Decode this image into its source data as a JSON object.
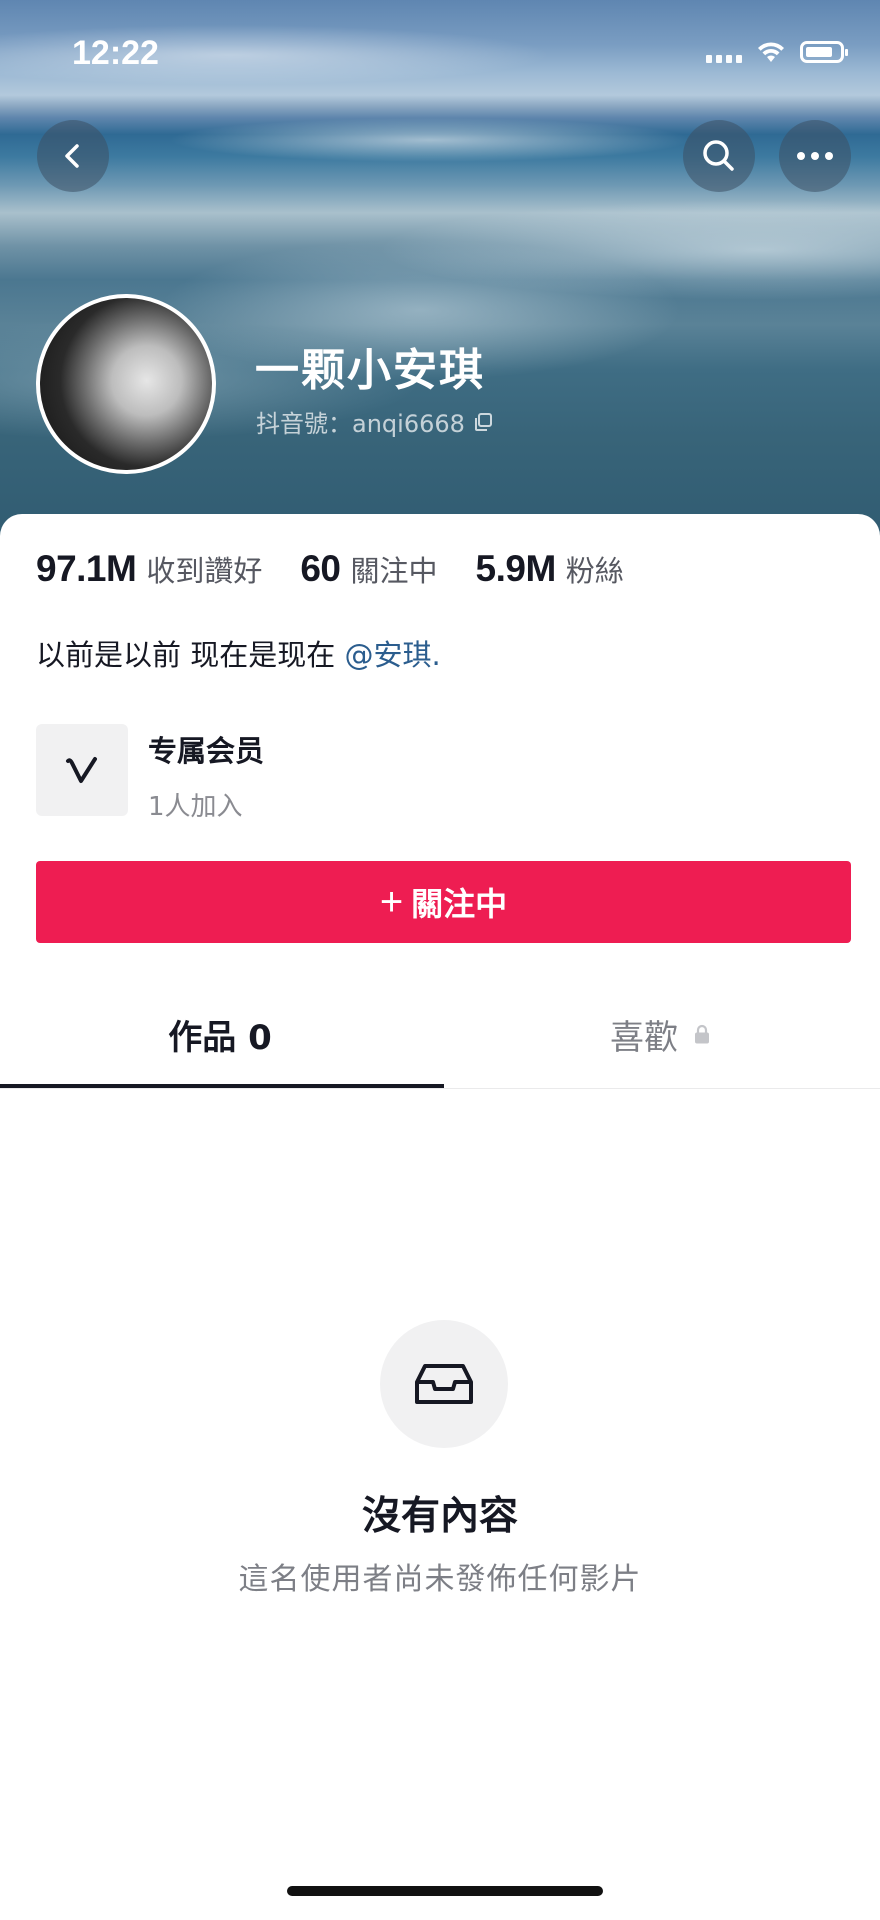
{
  "status_bar": {
    "time": "12:22"
  },
  "profile": {
    "name": "一颗小安琪",
    "id_label": "抖音號：anqi6668"
  },
  "stats": [
    {
      "value": "97.1M",
      "label": "收到讚好"
    },
    {
      "value": "60",
      "label": "關注中"
    },
    {
      "value": "5.9M",
      "label": "粉絲"
    }
  ],
  "bio": {
    "text": "以前是以前 现在是现在 ",
    "mention": "@安琪",
    "suffix": "."
  },
  "membership": {
    "title": "专属会员",
    "subtitle": "1人加入"
  },
  "follow_button": {
    "plus": "+",
    "label": "關注中"
  },
  "tabs": [
    {
      "label": "作品 0",
      "active": true
    },
    {
      "label": "喜歡",
      "locked": true
    }
  ],
  "empty_state": {
    "title": "沒有內容",
    "subtitle": "這名使用者尚未發佈任何影片"
  },
  "colors": {
    "accent": "#ee1d52",
    "mention": "#2b5d8e",
    "text": "#161823",
    "muted": "#7d7f86"
  },
  "icons": [
    "back-chevron-icon",
    "search-icon",
    "more-icon",
    "copy-icon",
    "membership-v-icon",
    "lock-icon",
    "inbox-tray-icon",
    "wifi-icon",
    "signal-icon",
    "battery-icon"
  ]
}
